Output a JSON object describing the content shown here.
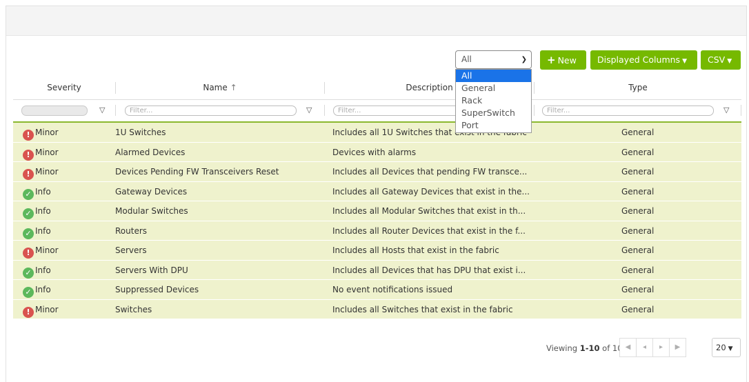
{
  "toolbar": {
    "filter_value": "All",
    "new_label": "New",
    "columns_label": "Displayed Columns",
    "csv_label": "CSV"
  },
  "dropdown": {
    "options": [
      "All",
      "General",
      "Rack",
      "SuperSwitch",
      "Port"
    ],
    "selected": "All"
  },
  "table": {
    "columns": [
      "Severity",
      "Name",
      "Description",
      "Type"
    ],
    "sort_indicator": "↑",
    "filter_placeholder": "Filter...",
    "rows": [
      {
        "severity": "Minor",
        "name": "1U Switches",
        "description": "Includes all 1U Switches that exist in the fabric",
        "type": "General"
      },
      {
        "severity": "Minor",
        "name": "Alarmed Devices",
        "description": "Devices with alarms",
        "type": "General"
      },
      {
        "severity": "Minor",
        "name": "Devices Pending FW Transceivers Reset",
        "description": "Includes all Devices that pending FW transce...",
        "type": "General"
      },
      {
        "severity": "Info",
        "name": "Gateway Devices",
        "description": "Includes all Gateway Devices that exist in the...",
        "type": "General"
      },
      {
        "severity": "Info",
        "name": "Modular Switches",
        "description": "Includes all Modular Switches that exist in th...",
        "type": "General"
      },
      {
        "severity": "Info",
        "name": "Routers",
        "description": "Includes all Router Devices that exist in the f...",
        "type": "General"
      },
      {
        "severity": "Minor",
        "name": "Servers",
        "description": "Includes all Hosts that exist in the fabric",
        "type": "General"
      },
      {
        "severity": "Info",
        "name": "Servers With DPU",
        "description": "Includes all Devices that has DPU that exist i...",
        "type": "General"
      },
      {
        "severity": "Info",
        "name": "Suppressed Devices",
        "description": "No event notifications issued",
        "type": "General"
      },
      {
        "severity": "Minor",
        "name": "Switches",
        "description": "Includes all Switches that exist in the fabric",
        "type": "General"
      }
    ]
  },
  "pager": {
    "viewing_prefix": "Viewing ",
    "viewing_range": "1-10",
    "viewing_of": " of 10",
    "page_size": "20"
  },
  "colors": {
    "accent": "#76b900",
    "row_bg": "#eff2cd",
    "minor": "#d9534f",
    "info": "#5cb85c",
    "selected_option": "#1a73e8"
  }
}
